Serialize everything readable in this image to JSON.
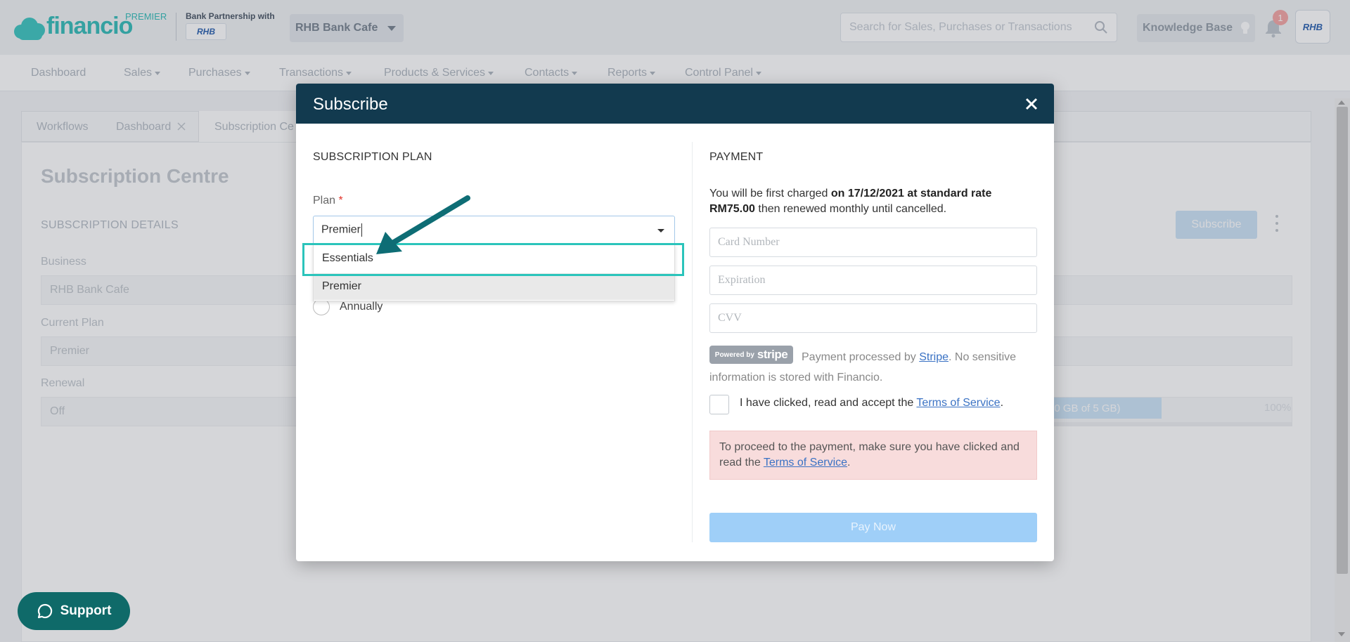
{
  "app": {
    "logo_text": "financio",
    "plan_tag": "PREMIER",
    "bank_partnership_label": "Bank Partnership with",
    "bank_logo_text": "RHB",
    "business_name": "RHB Bank Cafe",
    "search_placeholder": "Search for Sales, Purchases or Transactions",
    "knowledge_base_label": "Knowledge Base",
    "notification_count": "1",
    "avatar_text": "RHB"
  },
  "nav": {
    "items": [
      {
        "label": "Dashboard"
      },
      {
        "label": "Sales"
      },
      {
        "label": "Purchases"
      },
      {
        "label": "Transactions"
      },
      {
        "label": "Products & Services"
      },
      {
        "label": "Contacts"
      },
      {
        "label": "Reports"
      },
      {
        "label": "Control Panel"
      }
    ]
  },
  "tabs": {
    "workflows": "Workflows",
    "dashboard": "Dashboard",
    "subscription": "Subscription Ce"
  },
  "page": {
    "title": "Subscription Centre",
    "section_label": "SUBSCRIPTION DETAILS",
    "subscribe_button": "Subscribe",
    "fields": {
      "business_label": "Business",
      "business_value": "RHB Bank Cafe",
      "current_plan_label": "Current Plan",
      "current_plan_value": "Premier",
      "renewal_label": "Renewal",
      "renewal_value": "Off"
    },
    "storage_text": "00 GB of 5 GB)",
    "storage_percent": "100%"
  },
  "modal": {
    "title": "Subscribe",
    "plan_section": "SUBSCRIPTION PLAN",
    "plan_label": "Plan",
    "required_mark": "*",
    "plan_value": "Premier",
    "plan_options": [
      "Essentials",
      "Premier"
    ],
    "billing_option": "Annually",
    "payment_section": "PAYMENT",
    "charge_prefix": "You will be first charged ",
    "charge_bold": "on 17/12/2021 at standard rate RM75.00",
    "charge_suffix": " then renewed monthly until cancelled.",
    "card_placeholder": "Card Number",
    "expiry_placeholder": "Expiration",
    "cvv_placeholder": "CVV",
    "stripe_badge_small": "Powered by",
    "stripe_badge_big": "stripe",
    "stripe_text_prefix": "Payment processed by ",
    "stripe_link": "Stripe",
    "stripe_text_suffix": ". No sensitive information is stored with Financio.",
    "tos_prefix": "I have clicked, read and accept the ",
    "tos_link": "Terms of Service",
    "tos_suffix": ".",
    "alert_prefix": "To proceed to the payment, make sure you have clicked and read the ",
    "alert_link": "Terms of Service",
    "alert_suffix": ".",
    "pay_button": "Pay Now"
  },
  "support_label": "Support",
  "colors": {
    "modal_header": "#123a4f",
    "accent_teal": "#2bc4bb",
    "arrow": "#0e6d75",
    "pay_button": "#9fcff8",
    "alert_bg": "#f8dcdc"
  }
}
